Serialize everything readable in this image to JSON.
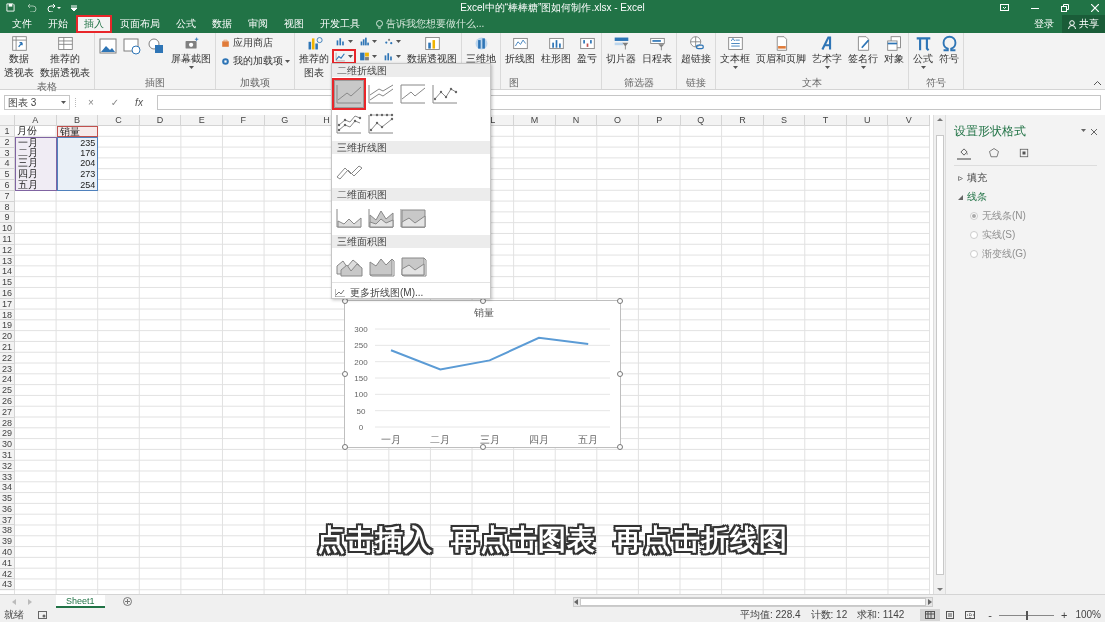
{
  "window": {
    "title": "Excel中的“棒棒糖”图如何制作.xlsx - Excel"
  },
  "ribbon_tabs": [
    {
      "label": "文件",
      "selected": false
    },
    {
      "label": "开始",
      "selected": false
    },
    {
      "label": "插入",
      "selected": true,
      "highlighted": true
    },
    {
      "label": "页面布局",
      "selected": false
    },
    {
      "label": "公式",
      "selected": false
    },
    {
      "label": "数据",
      "selected": false
    },
    {
      "label": "审阅",
      "selected": false
    },
    {
      "label": "视图",
      "selected": false
    },
    {
      "label": "开发工具",
      "selected": false
    }
  ],
  "tell_me": {
    "placeholder": "告诉我您想要做什么..."
  },
  "account": {
    "sign_in": "登录",
    "share": "共享"
  },
  "ribbon_groups": [
    {
      "label": "表格",
      "buttons": [
        {
          "kind": "large",
          "lines": [
            "数据",
            "透视表"
          ]
        },
        {
          "kind": "large",
          "lines": [
            "推荐的",
            "数据透视表"
          ]
        }
      ]
    },
    {
      "label": "插图",
      "buttons": [
        {
          "kind": "icon"
        },
        {
          "kind": "icon"
        },
        {
          "kind": "icon"
        },
        {
          "kind": "large",
          "lines": [
            "屏幕截图"
          ],
          "dropdown": true
        }
      ]
    },
    {
      "label": "加载项",
      "buttons": [
        {
          "kind": "small",
          "lines": [
            "应用商店"
          ]
        },
        {
          "kind": "small",
          "lines": [
            "我的加载项"
          ],
          "dropdown": true
        }
      ]
    },
    {
      "buttons": [
        {
          "kind": "large",
          "lines": [
            "推荐的",
            "图表"
          ]
        },
        {
          "kind": "small",
          "dropdown": true
        },
        {
          "kind": "small",
          "dropdown": true,
          "highlighted": true
        },
        {
          "kind": "small",
          "dropdown": true
        },
        {
          "kind": "small",
          "dropdown": true
        },
        {
          "kind": "small",
          "dropdown": true
        },
        {
          "kind": "small",
          "dropdown": true
        },
        {
          "kind": "large",
          "lines": [
            "数据透视图"
          ]
        }
      ]
    },
    {
      "buttons": [
        {
          "kind": "large",
          "lines": [
            "三维地"
          ]
        }
      ]
    },
    {
      "label": "图",
      "buttons": [
        {
          "kind": "large",
          "lines": [
            "折线图"
          ]
        },
        {
          "kind": "large",
          "lines": [
            "柱形图"
          ]
        },
        {
          "kind": "large",
          "lines": [
            "盈亏"
          ]
        }
      ]
    },
    {
      "label": "筛选器",
      "buttons": [
        {
          "kind": "large",
          "lines": [
            "切片器"
          ]
        },
        {
          "kind": "large",
          "lines": [
            "日程表"
          ]
        }
      ]
    },
    {
      "label": "链接",
      "buttons": [
        {
          "kind": "large",
          "lines": [
            "超链接"
          ]
        }
      ]
    },
    {
      "label": "文本",
      "buttons": [
        {
          "kind": "large",
          "lines": [
            "文本框"
          ],
          "dropdown": true
        },
        {
          "kind": "large",
          "lines": [
            "页眉和页脚"
          ]
        },
        {
          "kind": "large",
          "lines": [
            "艺术字"
          ],
          "dropdown": true
        },
        {
          "kind": "large",
          "lines": [
            "签名行"
          ],
          "dropdown": true
        },
        {
          "kind": "large",
          "lines": [
            "对象"
          ]
        }
      ]
    },
    {
      "label": "符号",
      "buttons": [
        {
          "kind": "large",
          "lines": [
            "公式"
          ],
          "dropdown": true
        },
        {
          "kind": "large",
          "lines": [
            "符号"
          ]
        }
      ]
    }
  ],
  "formula_bar": {
    "name_box": "图表 3",
    "cancel": "×",
    "enter": "✓",
    "function": "fx"
  },
  "sheet": {
    "columns": [
      {
        "label": "A"
      },
      {
        "label": "B"
      },
      {
        "label": "C"
      },
      {
        "label": "D"
      },
      {
        "label": "E"
      },
      {
        "label": "F"
      },
      {
        "label": "G"
      },
      {
        "label": "H"
      },
      {},
      {},
      {},
      {
        "label": "L"
      },
      {
        "label": "M"
      },
      {
        "label": "N"
      },
      {
        "label": "O"
      },
      {
        "label": "P"
      },
      {
        "label": "Q"
      },
      {
        "label": "R"
      },
      {
        "label": "S"
      },
      {
        "label": "T"
      },
      {
        "label": "U"
      },
      {
        "label": "V"
      }
    ],
    "rows": [
      {
        "number": "1",
        "cells": [
          {
            "text": "月份",
            "kind": "text"
          },
          {
            "text": "销量",
            "kind": "text",
            "color": "#c0504d"
          }
        ]
      },
      {
        "number": "2",
        "cells": [
          {
            "text": "一月",
            "kind": "text",
            "color": "#8064a2"
          },
          {
            "text": "235",
            "kind": "number",
            "color": "#4f81bd"
          }
        ]
      },
      {
        "number": "3",
        "cells": [
          {
            "text": "二月",
            "kind": "text",
            "color": "#8064a2"
          },
          {
            "text": "176",
            "kind": "number",
            "color": "#4f81bd"
          }
        ]
      },
      {
        "number": "4",
        "cells": [
          {
            "text": "三月",
            "kind": "text",
            "color": "#8064a2"
          },
          {
            "text": "204",
            "kind": "number",
            "color": "#4f81bd"
          }
        ]
      },
      {
        "number": "5",
        "cells": [
          {
            "text": "四月",
            "kind": "text",
            "color": "#8064a2"
          },
          {
            "text": "273",
            "kind": "number",
            "color": "#4f81bd"
          }
        ]
      },
      {
        "number": "6",
        "cells": [
          {
            "text": "五月",
            "kind": "text",
            "color": "#8064a2"
          },
          {
            "text": "254",
            "kind": "number",
            "color": "#4f81bd"
          }
        ]
      },
      {
        "number": "7"
      },
      {
        "number": "8"
      },
      {
        "number": "9"
      },
      {
        "number": "10"
      },
      {
        "number": "11"
      },
      {
        "number": "12"
      },
      {
        "number": "13"
      },
      {
        "number": "14"
      },
      {
        "number": "15"
      },
      {
        "number": "16"
      },
      {
        "number": "17"
      },
      {
        "number": "18"
      },
      {
        "number": "19"
      },
      {
        "number": "20"
      },
      {
        "number": "21"
      },
      {
        "number": "22"
      },
      {
        "number": "23"
      },
      {
        "number": "24"
      },
      {
        "number": "25"
      },
      {
        "number": "26"
      },
      {
        "number": "27"
      },
      {
        "number": "28"
      },
      {
        "number": "29"
      },
      {
        "number": "30"
      },
      {
        "number": "31"
      },
      {
        "number": "32"
      },
      {
        "number": "33"
      },
      {
        "number": "34"
      },
      {
        "number": "35"
      },
      {
        "number": "36"
      },
      {
        "number": "37"
      },
      {
        "number": "38"
      },
      {
        "number": "39"
      },
      {
        "number": "40"
      },
      {
        "number": "41"
      },
      {
        "number": "42"
      },
      {
        "number": "43"
      }
    ]
  },
  "chart": {
    "selected": true,
    "chart_data": {
      "type": "line",
      "categories": [
        "一月",
        "二月",
        "三月",
        "四月",
        "五月"
      ],
      "ylim": [
        0,
        300
      ],
      "yticks": [
        0,
        50,
        100,
        150,
        200,
        250,
        300
      ],
      "grid": true,
      "series": [
        {
          "name": "销量",
          "color": "#5b9bd5",
          "values": [
            235,
            176,
            204,
            273,
            254
          ]
        }
      ]
    }
  },
  "gallery": {
    "sections": [
      {
        "label": "二维折线图",
        "items": [
          {
            "kind": "line",
            "selected": true,
            "highlighted": true
          },
          {
            "kind": "stacked",
            "selected": false
          },
          {
            "kind": "percent",
            "selected": false
          },
          {
            "kind": "markers",
            "selected": false
          },
          {
            "kind": "stackedmarkers",
            "selected": false
          },
          {
            "kind": "percentmarkers",
            "selected": false
          }
        ]
      },
      {
        "label": "三维折线图",
        "items": [
          {
            "kind": "line3d",
            "selected": false
          }
        ]
      },
      {
        "label": "二维面积图",
        "items": [
          {
            "kind": "area",
            "selected": false
          },
          {
            "kind": "stackedarea",
            "selected": false
          },
          {
            "kind": "percentarea",
            "selected": false
          }
        ]
      },
      {
        "label": "三维面积图",
        "items": [
          {
            "kind": "area3d",
            "selected": false
          },
          {
            "kind": "stackedarea3d",
            "selected": false
          },
          {
            "kind": "percentarea3d",
            "selected": false
          }
        ]
      }
    ],
    "more": "更多折线图(M)..."
  },
  "format_pane": {
    "title": "设置形状格式",
    "tabs": [
      {
        "selected": true
      },
      {
        "selected": false
      },
      {
        "selected": false
      }
    ],
    "sections": [
      {
        "label": "填充",
        "expanded": false
      },
      {
        "label": "线条",
        "expanded": true,
        "options": [
          {
            "label": "无线条(N)",
            "selected": true,
            "disabled": true
          },
          {
            "label": "实线(S)",
            "selected": false,
            "disabled": true
          },
          {
            "label": "渐变线(G)",
            "selected": false,
            "disabled": true
          }
        ]
      }
    ]
  },
  "sheet_tabs": [
    {
      "label": "Sheet1",
      "selected": true
    }
  ],
  "status_bar": {
    "ready": "就绪",
    "average": "平均值: 228.4",
    "count": "计数: 12",
    "sum": "求和: 1142",
    "views": [
      {
        "selected": true
      },
      {
        "selected": false
      },
      {
        "selected": false
      }
    ],
    "zoom_out": "-",
    "zoom_in": "+",
    "zoom": {
      "level": 0.5
    },
    "zoom_text": "100%"
  },
  "caption": "点击插入  再点击图表  再点击折线图"
}
